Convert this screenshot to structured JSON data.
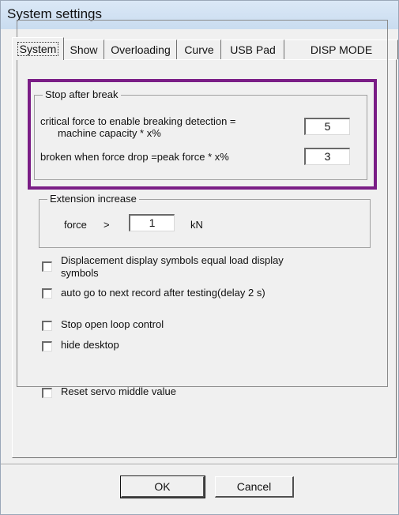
{
  "window": {
    "title": "System settings"
  },
  "tabs": [
    "System",
    "Show",
    "Overloading",
    "Curve",
    "USB Pad",
    "DISP MODE"
  ],
  "stop_after_break": {
    "legend": "Stop after break",
    "critical_label_line1": "critical force to enable breaking detection =",
    "critical_label_line2": "machine capacity * x%",
    "critical_value": "5",
    "broken_label": "broken when force drop =peak force * x%",
    "broken_value": "3"
  },
  "extension_increase": {
    "legend": "Extension increase",
    "force_label": "force",
    "comparator": ">",
    "force_value": "1",
    "unit": "kN"
  },
  "options": [
    {
      "label_line1": "Displacement display symbols equal load display",
      "label_line2": "symbols",
      "checked": false
    },
    {
      "label_line1": "auto go to next record after testing(delay 2 s)",
      "label_line2": "",
      "checked": false
    },
    {
      "label_line1": "Stop open loop control",
      "label_line2": "",
      "checked": false
    },
    {
      "label_line1": "hide desktop",
      "label_line2": "",
      "checked": false
    },
    {
      "label_line1": "Reset servo middle value",
      "label_line2": "",
      "checked": false
    }
  ],
  "buttons": {
    "ok": "OK",
    "cancel": "Cancel"
  },
  "colors": {
    "highlight": "#7a1d86",
    "dialog_bg": "#f0f0f0",
    "titlebar": "#c9dcf0"
  }
}
